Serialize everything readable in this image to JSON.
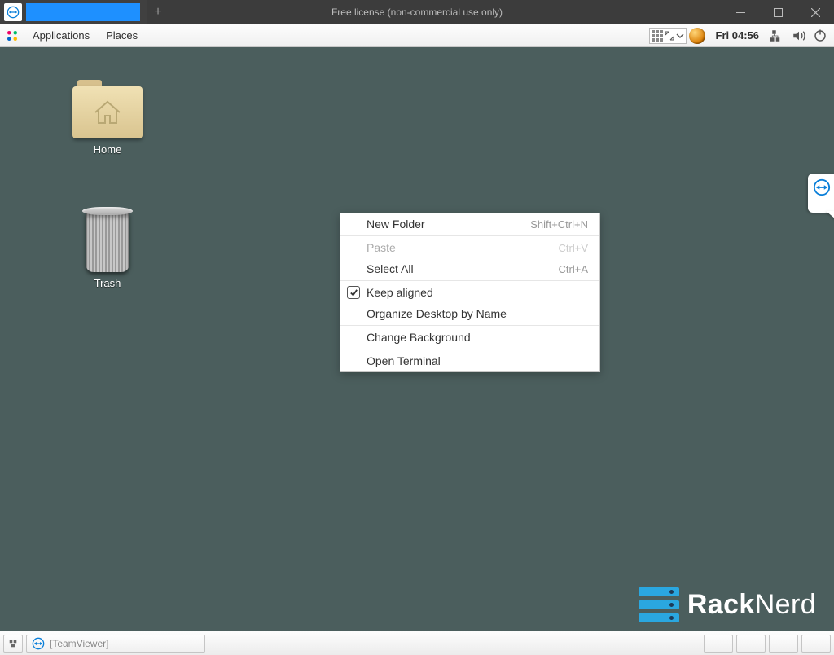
{
  "titlebar": {
    "title": "Free license (non-commercial use only)"
  },
  "panel": {
    "menus": {
      "applications": "Applications",
      "places": "Places"
    },
    "clock": "Fri 04:56"
  },
  "desktop": {
    "icons": {
      "home": "Home",
      "trash": "Trash"
    }
  },
  "context_menu": {
    "items": [
      {
        "label": "New Folder",
        "shortcut": "Shift+Ctrl+N",
        "disabled": false
      },
      {
        "label": "Paste",
        "shortcut": "Ctrl+V",
        "disabled": true
      },
      {
        "label": "Select All",
        "shortcut": "Ctrl+A",
        "disabled": false
      },
      {
        "label": "Keep aligned",
        "checked": true
      },
      {
        "label": "Organize Desktop by Name"
      },
      {
        "label": "Change Background"
      },
      {
        "label": "Open Terminal"
      }
    ]
  },
  "brand": {
    "strong": "Rack",
    "light": "Nerd"
  },
  "taskbar": {
    "task1": "[TeamViewer]"
  }
}
